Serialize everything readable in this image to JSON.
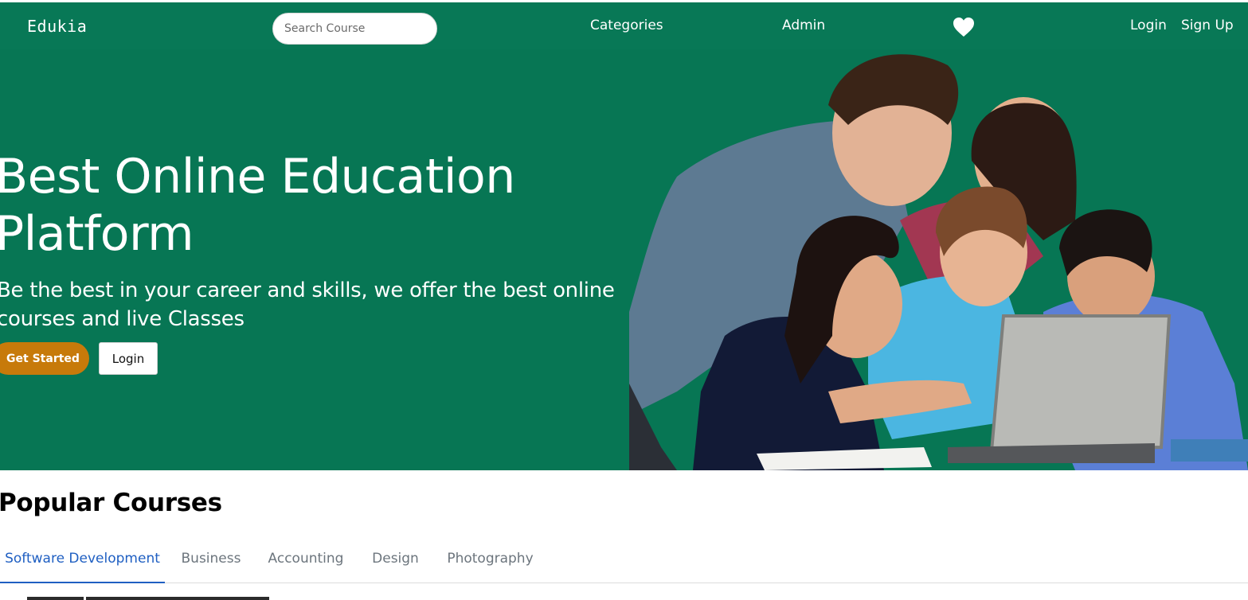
{
  "navbar": {
    "brand": "Edukia",
    "search_placeholder": "Search Course",
    "links": {
      "categories": "Categories",
      "admin": "Admin",
      "login": "Login",
      "signup": "Sign Up"
    },
    "wishlist_icon": "heart-icon"
  },
  "hero": {
    "title_line1": "Best Online Education",
    "title_line2": "Platform",
    "subtitle_line1": "Be the best in your career and skills, we offer the best online",
    "subtitle_line2": "courses and live Classes",
    "get_started_label": "Get Started",
    "login_label": "Login",
    "image": "students-around-laptop-photo"
  },
  "popular": {
    "title": "Popular Courses",
    "tabs": [
      {
        "label": "Software Development",
        "active": true
      },
      {
        "label": "Business",
        "active": false
      },
      {
        "label": "Accounting",
        "active": false
      },
      {
        "label": "Design",
        "active": false
      },
      {
        "label": "Photography",
        "active": false
      }
    ]
  },
  "colors": {
    "brand_green": "#077654",
    "cta_orange": "#c77a0a",
    "active_tab_blue": "#1f5fc2"
  }
}
